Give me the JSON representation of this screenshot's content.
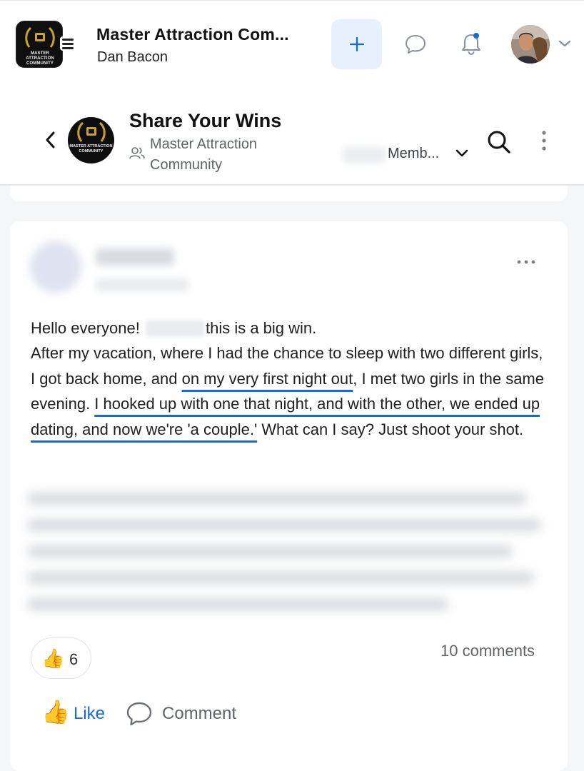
{
  "topbar": {
    "logo_text": "MASTER ATTRACTION COMMUNITY",
    "app_title": "Master Attraction Com...",
    "user_name": "Dan Bacon",
    "accent_color": "#1769d6",
    "icons": [
      "hamburger-icon",
      "plus-icon",
      "chat-icon",
      "bell-icon",
      "chevron-down-icon"
    ]
  },
  "group": {
    "title": "Share Your Wins",
    "logo_text": "MASTER ATTRACTION COMMUNITY",
    "community_name": "Master Attraction Community",
    "members_label": "Memb...",
    "icons": [
      "back-icon",
      "members-icon",
      "search-icon",
      "more-vertical-icon"
    ]
  },
  "post": {
    "line1_a": "Hello everyone! ",
    "line1_b": "this is a big win.",
    "body_1": "After my vacation, where I had the chance to sleep with two different girls, I got back home, and ",
    "body_2": "on my very first night out",
    "body_3": ", I met two girls in the same evening. ",
    "body_4": "I hooked up with one that night, and with the other, we ended up dating, and now we're 'a couple.'",
    "body_5": " What can I say? Just shoot your shot.",
    "reaction_emoji": "👍",
    "reaction_count": "6",
    "comments_count": "10 comments",
    "like_emoji": "👍",
    "like_label": "Like",
    "comment_label": "Comment"
  }
}
